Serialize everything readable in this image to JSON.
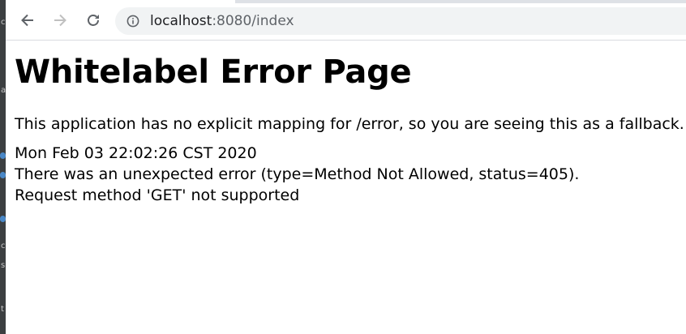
{
  "browser": {
    "url_host": "localhost",
    "url_rest": ":8080/index",
    "icons": {
      "back": "arrow-left-icon",
      "forward": "arrow-right-icon",
      "reload": "reload-icon",
      "site_info": "info-circle-icon"
    },
    "colors": {
      "omnibox_bg": "#f1f3f4",
      "url_host": "#202124",
      "url_rest": "#5f6368",
      "forward_disabled": "#c0c0c0"
    }
  },
  "page": {
    "title": "Whitelabel Error Page",
    "message": "This application has no explicit mapping for /error, so you are seeing this as a fallback.",
    "timestamp": "Mon Feb 03 22:02:26 CST 2020",
    "error": "There was an unexpected error (type=Method Not Allowed, status=405).",
    "detail": "Request method 'GET' not supported"
  }
}
